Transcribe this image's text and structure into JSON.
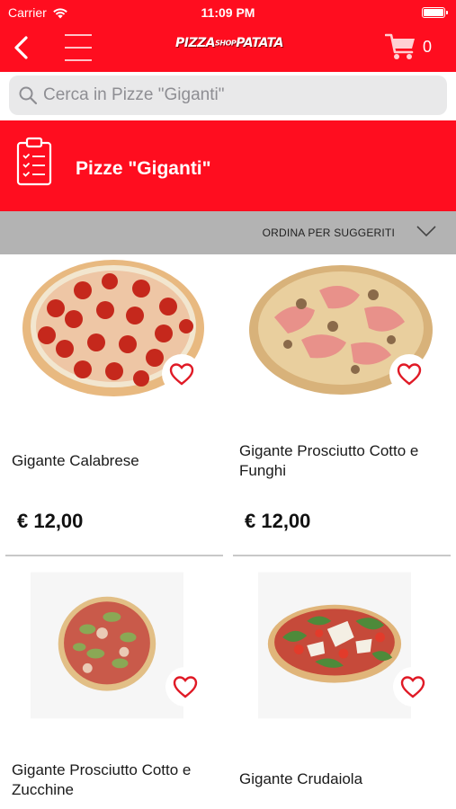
{
  "status_bar": {
    "carrier": "Carrier",
    "time": "11:09 PM"
  },
  "nav": {
    "logo_text": "PIZZASHOPPATATA",
    "cart_count": "0",
    "icons": [
      "back-chevron-icon",
      "hamburger-menu-icon",
      "cart-icon"
    ]
  },
  "search": {
    "placeholder": "Cerca in Pizze \"Giganti\""
  },
  "category": {
    "title": "Pizze \"Giganti\"",
    "icon": "clipboard-list-icon"
  },
  "sort": {
    "label": "ORDINA PER SUGGERITI"
  },
  "colors": {
    "brand_red": "#ff0d1f",
    "sort_bar": "#b3b3b3",
    "search_bg": "#e9e9ea"
  },
  "products": [
    {
      "name": "Gigante Calabrese",
      "price": "€ 12,00",
      "image": "pepperoni-pizza"
    },
    {
      "name": "Gigante Prosciutto Cotto e Funghi",
      "price": "€ 12,00",
      "image": "ham-mushroom-pizza"
    },
    {
      "name": "Gigante Prosciutto Cotto e Zucchine",
      "price": "",
      "image": "ham-zucchini-pizza"
    },
    {
      "name": "Gigante Crudaiola",
      "price": "",
      "image": "crudaiola-pizza"
    }
  ]
}
